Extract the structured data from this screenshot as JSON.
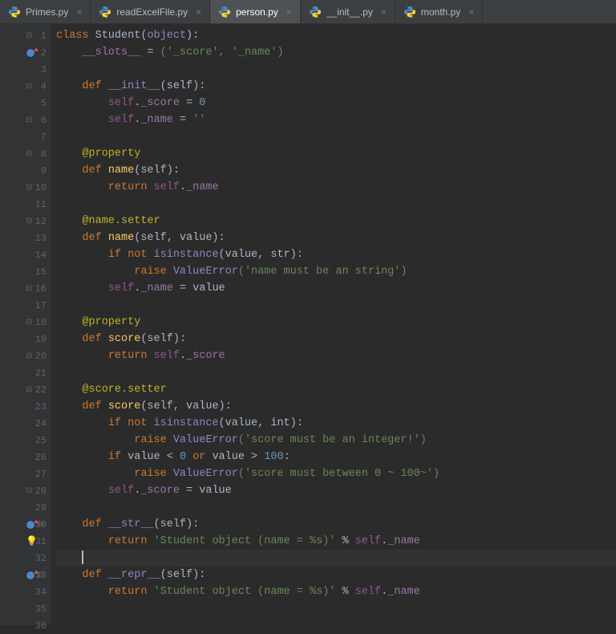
{
  "tabs": {
    "t0": "Primes.py",
    "t1": "readExcelFile.py",
    "t2": "person.py",
    "t3": "__init__.py",
    "t4": "month.py"
  },
  "lines": {
    "n1": "1",
    "n2": "2",
    "n3": "3",
    "n4": "4",
    "n5": "5",
    "n6": "6",
    "n7": "7",
    "n8": "8",
    "n9": "9",
    "n10": "10",
    "n11": "11",
    "n12": "12",
    "n13": "13",
    "n14": "14",
    "n15": "15",
    "n16": "16",
    "n17": "17",
    "n18": "18",
    "n19": "19",
    "n20": "20",
    "n21": "21",
    "n22": "22",
    "n23": "23",
    "n24": "24",
    "n25": "25",
    "n26": "26",
    "n27": "27",
    "n28": "28",
    "n29": "29",
    "n30": "30",
    "n31": "31",
    "n32": "32",
    "n33": "33",
    "n34": "34",
    "n35": "35",
    "n36": "36"
  },
  "tok": {
    "class": "class ",
    "Student": "Student",
    "lpar": "(",
    "object": "object",
    "rpar": ")",
    "colon": ":",
    "slots": "__slots__",
    "eq": " = ",
    "slotsTuple": "('_score', '_name')",
    "def": "def ",
    "initFn": "__init__",
    "self": "self",
    "selfp": "(self)",
    "selfvp": "(self, value)",
    "selfDot": "self",
    "dot": ".",
    "uscore": "_score",
    "uname": "_name",
    "assign0": " = ",
    "zero": "0",
    "empty": "''",
    "propDeco": "@property",
    "nameSet": "@name.setter",
    "scoreSet": "@score.setter",
    "nameFn": "name",
    "scoreFn": "score",
    "strFn": "__str__",
    "reprFn": "__repr__",
    "ret": "return ",
    "ifNot": "if not ",
    "isinst": "isinstance",
    "valStr": "(value, str)",
    "valInt": "(value, int)",
    "raise": "raise ",
    "ValueErr": "ValueError",
    "errName": "('name must be an string')",
    "errInt": "('score must be an integer!')",
    "errRange": "('score must between 0 ~ 100~')",
    "assignVal": " = value",
    "ifVal": "if ",
    "valLt": "value < ",
    "zeroOr": " or ",
    "valGt": "value > ",
    "hundred": "100",
    "zeroN": "0",
    "retStr1": "'Student object (name = %s)'",
    "pct": " % ",
    "comma": ", ",
    "value": "value"
  }
}
